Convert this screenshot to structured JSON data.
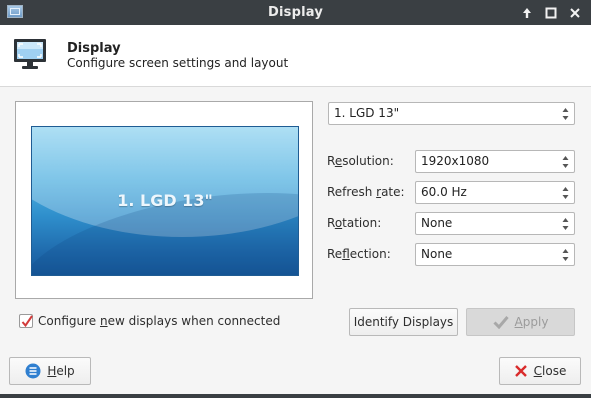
{
  "window": {
    "title": "Display",
    "controls": [
      "up-arrow-icon",
      "maximize-icon",
      "close-icon"
    ]
  },
  "header": {
    "title": "Display",
    "subtitle": "Configure screen settings and layout",
    "icon": "display-monitor-icon"
  },
  "preview": {
    "monitor_label": "1. LGD 13\""
  },
  "display_selector": {
    "value": "1. LGD 13\""
  },
  "settings": {
    "resolution": {
      "label_pre": "R",
      "label_ul": "e",
      "label_post": "solution:",
      "value": "1920x1080"
    },
    "refresh_rate": {
      "label_pre": "Refresh ",
      "label_ul": "r",
      "label_post": "ate:",
      "value": "60.0 Hz"
    },
    "rotation": {
      "label_pre": "R",
      "label_ul": "o",
      "label_post": "tation:",
      "value": "None"
    },
    "reflection": {
      "label_pre": "Re",
      "label_ul": "f",
      "label_post": "lection:",
      "value": "None"
    }
  },
  "auto_config": {
    "checked": true,
    "label_pre": "Configure ",
    "label_ul": "n",
    "label_post": "ew displays when connected"
  },
  "buttons": {
    "identify": "Identify Displays",
    "apply_ul": "A",
    "apply_post": "pply",
    "help_ul": "H",
    "help_post": "elp",
    "close_ul": "C",
    "close_post": "lose"
  },
  "colors": {
    "titlebar": "#3a3f43",
    "monitor_top": "#8fd3f0",
    "monitor_bottom": "#17599a",
    "checkbox_mark": "#d23b3b",
    "close_icon": "#d92b2b",
    "help_icon": "#2f7fd0"
  }
}
